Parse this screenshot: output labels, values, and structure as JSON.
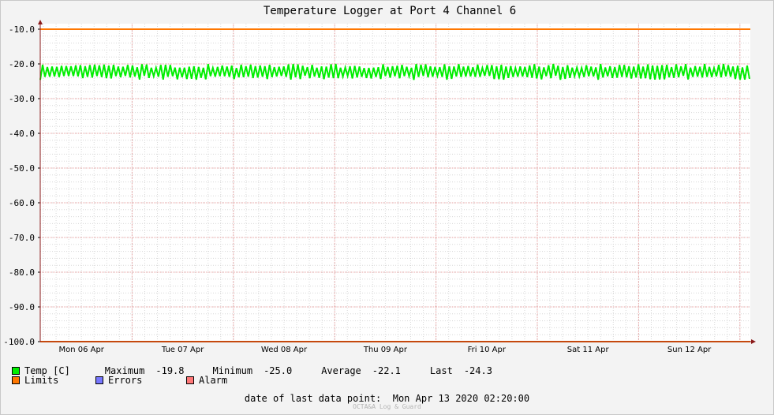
{
  "chart_data": {
    "type": "line",
    "title": "Temperature Logger at Port 4 Channel 6",
    "ylim": [
      -100.0,
      -10.0
    ],
    "y_ticks": [
      "-10.0",
      "-20.0",
      "-30.0",
      "-40.0",
      "-50.0",
      "-60.0",
      "-70.0",
      "-80.0",
      "-90.0",
      "-100.0"
    ],
    "x_ticks": [
      "Mon 06 Apr",
      "Tue 07 Apr",
      "Wed 08 Apr",
      "Thu 09 Apr",
      "Fri 10 Apr",
      "Sat 11 Apr",
      "Sun 12 Apr"
    ],
    "grid": true,
    "series": [
      {
        "name": "Temp [C]",
        "color": "#00ee00",
        "min": -25.0,
        "max": -19.8,
        "mean": -22.1,
        "last": -24.3,
        "style": "noisy band"
      },
      {
        "name": "Limits",
        "color": "#ff7700",
        "values": [
          -10.0,
          -100.0
        ]
      }
    ]
  },
  "legend": {
    "temp_label": "Temp [C]",
    "maximum_label": "Maximum",
    "maximum_value": "-19.8",
    "minimum_label": "Minimum",
    "minimum_value": "-25.0",
    "average_label": "Average",
    "average_value": "-22.1",
    "last_label": "Last",
    "last_value": "-24.3",
    "limits_label": "Limits",
    "errors_label": "Errors",
    "alarm_label": "Alarm",
    "colors": {
      "temp": "#00ee00",
      "limits": "#ff7700",
      "errors": "#7777ff",
      "alarm": "#ff7777"
    }
  },
  "footer": {
    "label": "date of last data point:",
    "value": "Mon Apr 13 2020 02:20:00"
  },
  "watermark": "OCTA&A Log & Guard"
}
